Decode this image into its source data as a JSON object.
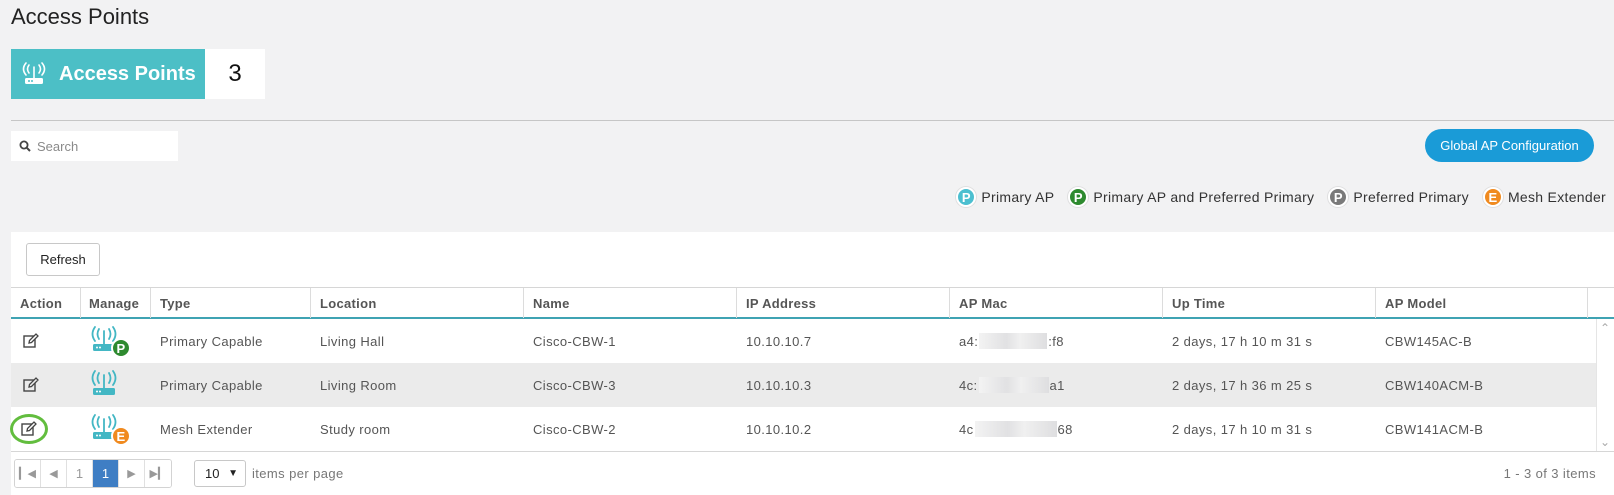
{
  "page": {
    "title": "Access Points"
  },
  "summary": {
    "label": "Access Points",
    "count": "3"
  },
  "search": {
    "placeholder": "Search"
  },
  "toolbar": {
    "global_ap_label": "Global AP Configuration",
    "refresh_label": "Refresh"
  },
  "legend": [
    {
      "letter": "P",
      "label": "Primary AP",
      "color": "#4cbfd0"
    },
    {
      "letter": "P",
      "label": "Primary AP and Preferred Primary",
      "color": "#2e8a2f"
    },
    {
      "letter": "P",
      "label": "Preferred Primary",
      "color": "#7a7a7a"
    },
    {
      "letter": "E",
      "label": "Mesh Extender",
      "color": "#f08a1f"
    }
  ],
  "table": {
    "columns": [
      "Action",
      "Manage",
      "Type",
      "Location",
      "Name",
      "IP Address",
      "AP Mac",
      "Up Time",
      "AP Model"
    ],
    "rows": [
      {
        "type": "Primary Capable",
        "location": "Living Hall",
        "name": "Cisco-CBW-1",
        "ip": "10.10.10.7",
        "mac_prefix": "a4:",
        "mac_suffix": ":f8",
        "uptime": "2 days, 17 h 10 m 31 s",
        "model": "CBW145AC-B",
        "badge": "P",
        "badge_color": "#2e8a2f"
      },
      {
        "type": "Primary Capable",
        "location": "Living Room",
        "name": "Cisco-CBW-3",
        "ip": "10.10.10.3",
        "mac_prefix": "4c:",
        "mac_suffix": "a1",
        "uptime": "2 days, 17 h 36 m 25 s",
        "model": "CBW140ACM-B",
        "badge": "",
        "badge_color": ""
      },
      {
        "type": "Mesh Extender",
        "location": "Study room",
        "name": "Cisco-CBW-2",
        "ip": "10.10.10.2",
        "mac_prefix": "4c",
        "mac_suffix": "68",
        "uptime": "2 days, 17 h 10 m 31 s",
        "model": "CBW141ACM-B",
        "badge": "E",
        "badge_color": "#f08a1f"
      }
    ]
  },
  "pager": {
    "prev_page": "1",
    "current_page": "1",
    "page_size": "10",
    "items_per_page_label": "items per page",
    "range_text": "1 - 3 of 3 items"
  },
  "colors": {
    "accent": "#4cbfc6",
    "button_blue": "#1a9bd7",
    "pager_active": "#3f7ec4",
    "highlight_ring": "#62bd3e"
  }
}
